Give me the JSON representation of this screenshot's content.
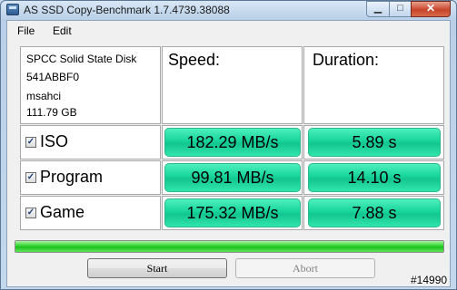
{
  "window": {
    "title": "AS SSD Copy-Benchmark 1.7.4739.38088"
  },
  "menu": {
    "file": "File",
    "edit": "Edit"
  },
  "drive": {
    "model": "SPCC Solid State Disk",
    "firmware": "541ABBF0",
    "driver": "msahci",
    "size": "111.79 GB"
  },
  "headers": {
    "speed": "Speed:",
    "duration": "Duration:"
  },
  "rows": [
    {
      "label": "ISO",
      "checked": true,
      "speed": "182.29 MB/s",
      "duration": "5.89 s"
    },
    {
      "label": "Program",
      "checked": true,
      "speed": "99.81 MB/s",
      "duration": "14.10 s"
    },
    {
      "label": "Game",
      "checked": true,
      "speed": "175.32 MB/s",
      "duration": "7.88 s"
    }
  ],
  "progress": {
    "fraction": 1.0
  },
  "buttons": {
    "start": "Start",
    "abort": "Abort"
  },
  "watermark": "#14990",
  "colors": {
    "result_fill": "#1bd9a0",
    "progress_fill": "#2fd42f"
  }
}
